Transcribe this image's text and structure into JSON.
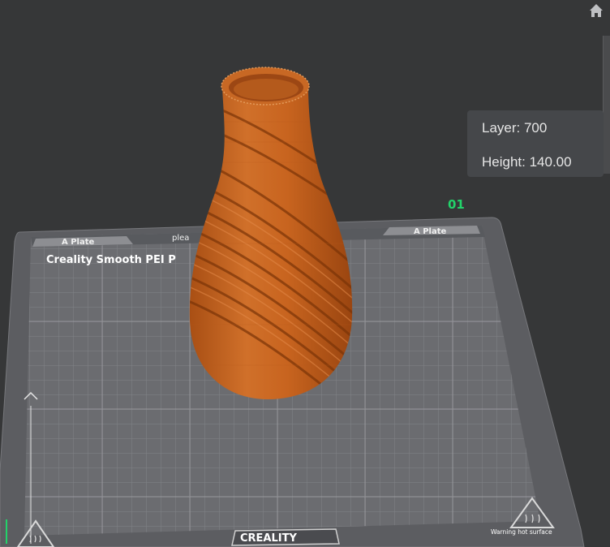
{
  "viewport": {
    "plate_number": "01",
    "plate_label_left": "A Plate",
    "plate_label_right": "A Plate",
    "plate_notice_partial": "plea",
    "plate_surface_name": "Creality Smooth PEI P",
    "brand_logo": "CREALITY",
    "warning_text": "Warning hot surface"
  },
  "layer_panel": {
    "layer_label": "Layer: 700",
    "height_label": "Height: 140.00"
  },
  "icons": {
    "home": "home-icon",
    "hot_surface": "hot-surface-warning-icon",
    "axis": "axis-gizmo-icon"
  },
  "colors": {
    "background": "#363738",
    "bed": "#6c6d71",
    "model": "#c8641f",
    "plate_number": "#22d36a",
    "panel": "#45474a"
  }
}
